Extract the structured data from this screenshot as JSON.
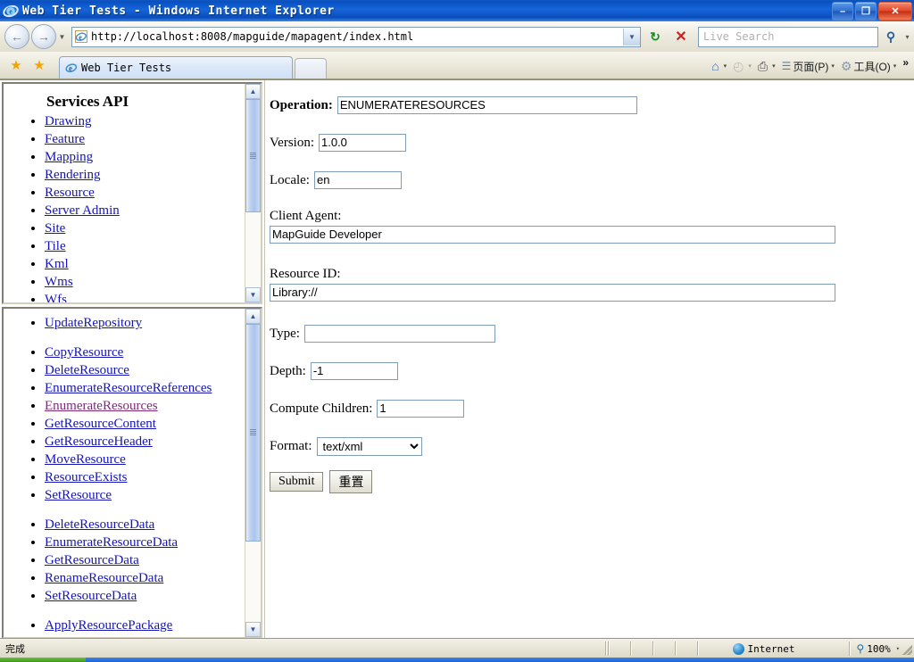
{
  "window": {
    "title": "Web Tier Tests - Windows Internet Explorer",
    "minimize_label": "–",
    "restore_label": "❐",
    "close_label": "✕",
    "logo_icon": "ie-logo-icon"
  },
  "navbar": {
    "back_label": "←",
    "forward_label": "→",
    "history_caret": "▼",
    "address_value": "http://localhost:8008/mapguide/mapagent/index.html",
    "address_dropdown_caret": "▼",
    "refresh_label": "↻",
    "stop_label": "✕",
    "search_placeholder": "Live Search",
    "search_go_label": "⚲",
    "search_dropdown_caret": "▾"
  },
  "tabs": {
    "favorites_icon_label": "★",
    "add_favorites_icon_label": "★",
    "active_tab_label": "Web Tier Tests",
    "new_tab_label": ""
  },
  "commandbar": {
    "items": [
      {
        "name": "home",
        "glyph": "⌂",
        "label": "",
        "caret": "▾"
      },
      {
        "name": "feeds",
        "glyph": "◴",
        "label": "",
        "caret": "▾"
      },
      {
        "name": "print",
        "glyph": "⎙",
        "label": "",
        "caret": "▾"
      },
      {
        "name": "page",
        "glyph": "☰",
        "label": "页面(P)",
        "caret": "▾"
      },
      {
        "name": "tools",
        "glyph": "⚙",
        "label": "工具(O)",
        "caret": "▾"
      }
    ],
    "overflow_label": "»"
  },
  "sidebar_top": {
    "heading": "Services API",
    "links": [
      "Drawing",
      "Feature",
      "Mapping",
      "Rendering",
      "Resource",
      "Server Admin",
      "Site",
      "Tile",
      "Kml",
      "Wms",
      "Wfs"
    ],
    "scroll": {
      "up": "▲",
      "down": "▼",
      "thumb_top_pct": 0,
      "thumb_height_pct": 60
    }
  },
  "sidebar_bottom": {
    "group1": [
      {
        "label": "UpdateRepository",
        "visited": false
      }
    ],
    "group2": [
      {
        "label": "CopyResource",
        "visited": false
      },
      {
        "label": "DeleteResource",
        "visited": false
      },
      {
        "label": "EnumerateResourceReferences",
        "visited": false
      },
      {
        "label": "EnumerateResources",
        "visited": true
      },
      {
        "label": "GetResourceContent",
        "visited": false
      },
      {
        "label": "GetResourceHeader",
        "visited": false
      },
      {
        "label": "MoveResource",
        "visited": false
      },
      {
        "label": "ResourceExists",
        "visited": false
      },
      {
        "label": "SetResource",
        "visited": false
      }
    ],
    "group3": [
      {
        "label": "DeleteResourceData",
        "visited": false
      },
      {
        "label": "EnumerateResourceData",
        "visited": false
      },
      {
        "label": "GetResourceData",
        "visited": false
      },
      {
        "label": "RenameResourceData",
        "visited": false
      },
      {
        "label": "SetResourceData",
        "visited": false
      }
    ],
    "group4": [
      {
        "label": "ApplyResourcePackage",
        "visited": false
      }
    ],
    "scroll": {
      "up": "▲",
      "down": "▼",
      "thumb_top_pct": 0,
      "thumb_height_pct": 73
    }
  },
  "form": {
    "operation_label": "Operation:",
    "operation_value": "ENUMERATERESOURCES",
    "version_label": "Version:",
    "version_value": "1.0.0",
    "locale_label": "Locale:",
    "locale_value": "en",
    "client_agent_label": "Client Agent:",
    "client_agent_value": "MapGuide Developer",
    "resource_id_label": "Resource ID:",
    "resource_id_value": "Library://",
    "type_label": "Type:",
    "type_value": "",
    "depth_label": "Depth:",
    "depth_value": "-1",
    "compute_children_label": "Compute Children:",
    "compute_children_value": "1",
    "format_label": "Format:",
    "format_value": "text/xml",
    "format_options": [
      "text/xml"
    ],
    "submit_label": "Submit",
    "reset_label": "重置"
  },
  "statusbar": {
    "status_text": "完成",
    "zone_label": "Internet",
    "zoom_label": "100%",
    "zoom_caret": "▾"
  }
}
